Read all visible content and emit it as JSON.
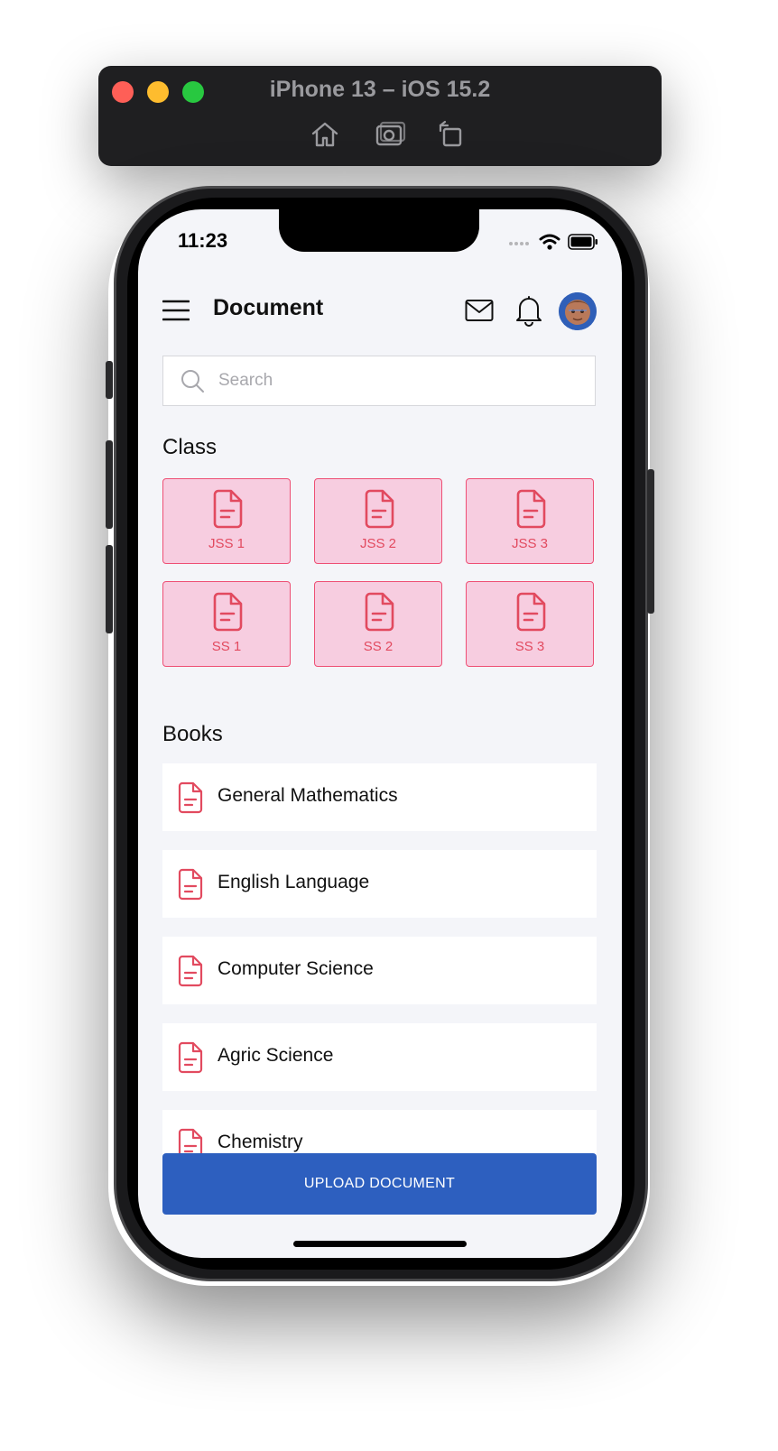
{
  "simulator": {
    "title": "iPhone 13 – iOS 15.2",
    "tools": [
      "home-icon",
      "screenshot-icon",
      "rotate-icon"
    ]
  },
  "status_bar": {
    "time": "11:23"
  },
  "header": {
    "title": "Document",
    "icons": [
      "menu-icon",
      "mail-icon",
      "bell-icon",
      "avatar"
    ]
  },
  "search": {
    "placeholder": "Search"
  },
  "class_section": {
    "title": "Class",
    "items": [
      {
        "label": "JSS 1"
      },
      {
        "label": "JSS 2"
      },
      {
        "label": "JSS 3"
      },
      {
        "label": "SS 1"
      },
      {
        "label": "SS 2"
      },
      {
        "label": "SS 3"
      }
    ]
  },
  "books_section": {
    "title": "Books",
    "items": [
      {
        "label": "General Mathematics"
      },
      {
        "label": "English Language"
      },
      {
        "label": "Computer Science"
      },
      {
        "label": "Agric Science"
      },
      {
        "label": "Chemistry"
      }
    ]
  },
  "upload_button": {
    "label": "UPLOAD DOCUMENT"
  },
  "colors": {
    "accent": "#e24a5f",
    "tile_background": "#f7cde0",
    "primary_button": "#2d5fbf",
    "screen_background": "#f4f5f9"
  }
}
